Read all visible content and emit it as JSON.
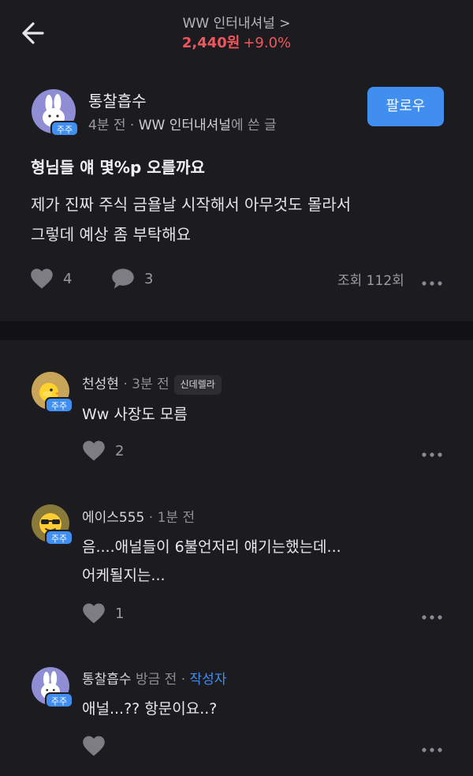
{
  "header": {
    "stock_name": "WW 인터내셔널 >",
    "price": "2,440원",
    "change": "+9.0%",
    "back_icon": "arrow-left-icon"
  },
  "post": {
    "author": "통찰흡수",
    "badge": "주주",
    "time": "4분 전",
    "separator": " · ",
    "board": "WW 인터내셔널",
    "board_suffix": "에 쓴 글",
    "follow_label": "팔로우",
    "title": "형님들 얘 몇%p 오를까요",
    "body_line1": "제가 진짜 주식 금욜날 시작해서 아무것도 몰라서",
    "body_line2": "그렇데 예상 좀 부탁해요",
    "likes": "4",
    "comments": "3",
    "views": "조회 112회"
  },
  "comments": [
    {
      "author": "천성현",
      "time": " · 3분 전",
      "tag": "신데렐라",
      "badge": "주주",
      "text_line1": "Ww 사장도 모름",
      "likes": "2"
    },
    {
      "author": "에이스555",
      "time": " · 1분 전",
      "badge": "주주",
      "text_line1": "음....애널들이 6불언저리 얘기는했는데...",
      "text_line2": "어케될지는...",
      "likes": "1"
    },
    {
      "author": "통찰흡수",
      "time": " 방금 전 · ",
      "writer": "작성자",
      "badge": "주주",
      "text_line1": "애널...?? 항문이요..?",
      "likes": ""
    }
  ],
  "colors": {
    "background": "#1c1c20",
    "accent": "#3f8ef0",
    "price_up": "#f0575d",
    "divider": "#121214"
  }
}
